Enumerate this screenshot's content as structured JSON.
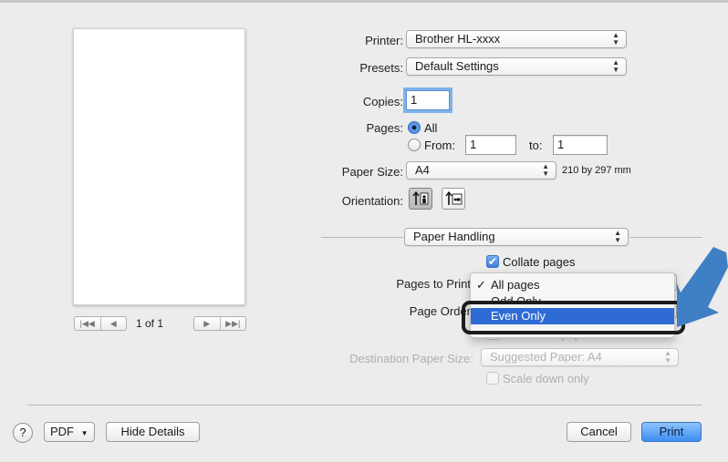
{
  "preview": {
    "page_indicator": "1 of 1"
  },
  "printer": {
    "label": "Printer:",
    "value": "Brother HL-xxxx"
  },
  "presets": {
    "label": "Presets:",
    "value": "Default Settings"
  },
  "copies": {
    "label": "Copies:",
    "value": "1"
  },
  "pages": {
    "label": "Pages:",
    "all_label": "All",
    "from_label": "From:",
    "from_value": "1",
    "to_label": "to:",
    "to_value": "1"
  },
  "paper_size": {
    "label": "Paper Size:",
    "value": "A4",
    "dimensions": "210 by 297 mm"
  },
  "orientation": {
    "label": "Orientation:"
  },
  "section": {
    "value": "Paper Handling"
  },
  "collate": {
    "label": "Collate pages",
    "checked": true
  },
  "pages_to_print": {
    "label": "Pages to Print"
  },
  "page_order": {
    "label": "Page Order"
  },
  "scale_to_fit": {
    "label": "Scale to fit paper size"
  },
  "destination": {
    "label": "Destination Paper Size:",
    "value": "Suggested Paper: A4"
  },
  "scale_down": {
    "label": "Scale down only"
  },
  "menu": {
    "check": "✓",
    "items": [
      "All pages",
      "Odd Only",
      "Even Only"
    ],
    "highlighted": "Even Only"
  },
  "footer": {
    "help": "?",
    "pdf": "PDF",
    "hide_details": "Hide Details",
    "cancel": "Cancel",
    "print": "Print"
  },
  "colors": {
    "highlight": "#2f6bd4",
    "callout_arrow": "#3f7fc4",
    "print_button": "#3d8ef2"
  }
}
